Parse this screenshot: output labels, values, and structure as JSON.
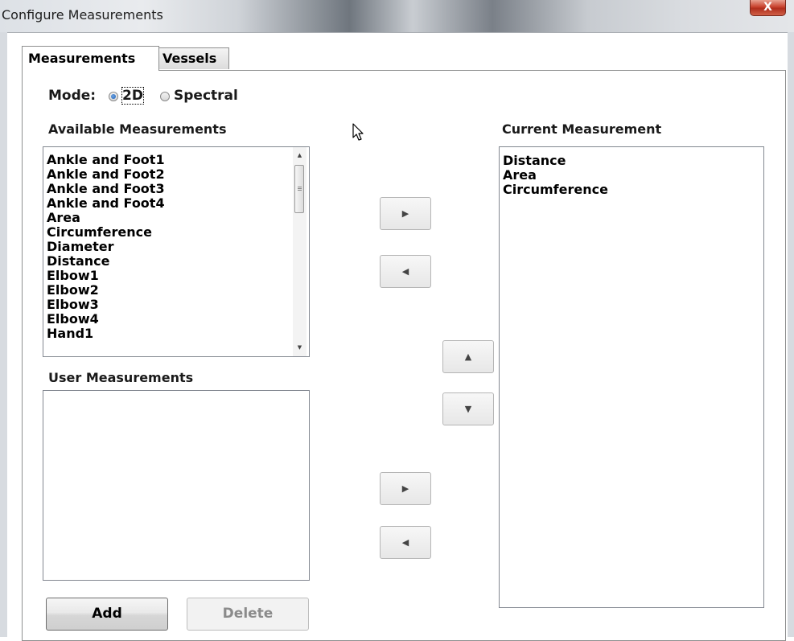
{
  "window": {
    "title": "Configure Measurements",
    "close_glyph": "X"
  },
  "tabs": [
    {
      "label": "Measurements",
      "active": true
    },
    {
      "label": "Vessels",
      "active": false
    }
  ],
  "mode": {
    "label": "Mode:",
    "options": [
      {
        "label": "2D",
        "selected": true
      },
      {
        "label": "Spectral",
        "selected": false
      }
    ]
  },
  "available": {
    "heading": "Available Measurements",
    "items": [
      "Ankle and Foot1",
      "Ankle and Foot2",
      "Ankle and Foot3",
      "Ankle and Foot4",
      "Area",
      "Circumference",
      "Diameter",
      "Distance",
      "Elbow1",
      "Elbow2",
      "Elbow3",
      "Elbow4",
      "Hand1"
    ]
  },
  "user": {
    "heading": "User Measurements",
    "items": []
  },
  "current": {
    "heading": "Current Measurement",
    "items": [
      "Distance",
      "Area",
      "Circumference"
    ]
  },
  "arrow_buttons": {
    "add_icon": "right-arrow-icon",
    "remove_icon": "left-arrow-icon",
    "up_icon": "up-arrow-icon",
    "down_icon": "down-arrow-icon"
  },
  "buttons": {
    "add": "Add",
    "delete": "Delete"
  },
  "colors": {
    "close_button": "#c8422e",
    "radio_selected": "#1c5fb8",
    "disabled_text": "#8b8b8b"
  }
}
